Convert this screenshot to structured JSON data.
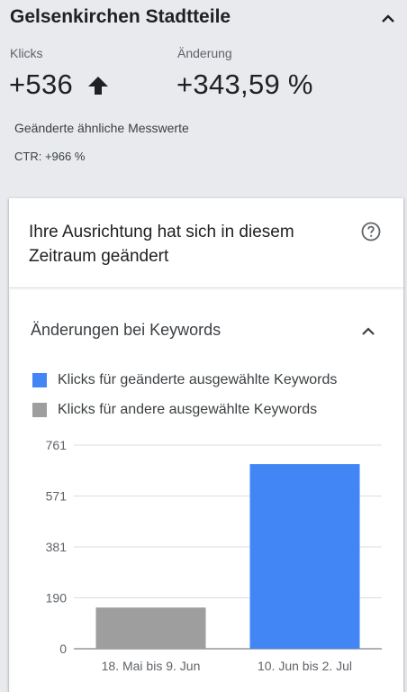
{
  "header": {
    "title": "Gelsenkirchen Stadtteile",
    "metrics": [
      {
        "label": "Klicks",
        "value": "+536"
      },
      {
        "label": "Änderung",
        "value": "+343,59 %"
      }
    ],
    "related_title": "Geänderte ähnliche Messwerte",
    "related_ctr": "CTR: +966 %"
  },
  "card": {
    "title": "Ihre Ausrichtung hat sich in diesem Zeitraum geändert",
    "section_title": "Änderungen bei Keywords",
    "legend": [
      {
        "label": "Klicks für geänderte ausgewählte Keywords",
        "color": "#4285f4"
      },
      {
        "label": "Klicks für andere ausgewählte Keywords",
        "color": "#9e9e9e"
      }
    ]
  },
  "chart_data": {
    "type": "bar",
    "categories": [
      "18. Mai bis 9. Jun",
      "10. Jun bis 2. Jul"
    ],
    "values": [
      154,
      690
    ],
    "colors": [
      "#9e9e9e",
      "#4285f4"
    ],
    "yticks": [
      "0",
      "190",
      "381",
      "571",
      "761"
    ],
    "ylim": [
      0,
      761
    ],
    "grid": true
  }
}
